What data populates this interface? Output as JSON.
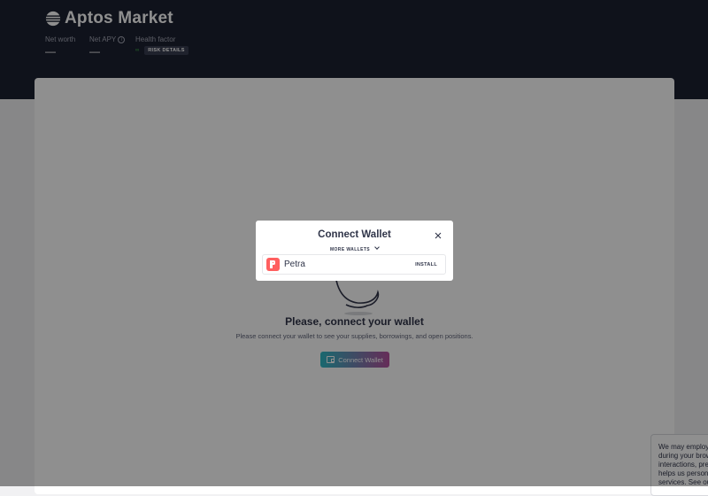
{
  "app": {
    "title": "Aptos Market"
  },
  "header": {
    "net_worth_label": "Net worth",
    "net_worth_value": "—",
    "net_apy_label": "Net APY",
    "net_apy_value": "—",
    "health_factor_label": "Health factor",
    "health_factor_value": "∞",
    "risk_details_label": "RISK DETAILS"
  },
  "empty_state": {
    "title": "Please, connect your wallet",
    "subtitle": "Please connect your wallet to see your supplies, borrowings, and open positions.",
    "button_label": "Connect Wallet"
  },
  "modal": {
    "title": "Connect Wallet",
    "more_wallets_label": "MORE WALLETS",
    "wallets": [
      {
        "name": "Petra",
        "action_label": "INSTALL"
      }
    ]
  },
  "cookie_banner": {
    "lines": [
      "We may employ c",
      "during your brow",
      "interactions, pref",
      "helps us persona",
      "services. See our"
    ]
  },
  "colors": {
    "header_bg": "#1b2030",
    "accent_gradient_start": "#2ebac6",
    "accent_gradient_end": "#b6509e",
    "health_good": "#46bc4b",
    "petra_brand": "#ff5f5f"
  },
  "icons": {
    "logo": "aptos-logo-icon",
    "info": "info-icon",
    "close": "close-icon",
    "chevron": "chevron-down-icon",
    "wallet": "wallet-icon",
    "petra": "petra-logo-icon"
  }
}
